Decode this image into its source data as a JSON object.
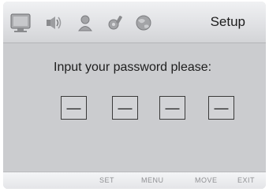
{
  "header": {
    "title": "Setup"
  },
  "icons": [
    "monitor-icon",
    "speaker-icon",
    "person-icon",
    "tools-icon",
    "globe-icon"
  ],
  "main": {
    "prompt": "Input your password please:",
    "password_slots": [
      "—",
      "—",
      "—",
      "—"
    ]
  },
  "footer": {
    "set_label": "SET",
    "menu_label": "MENU",
    "move_label": "MOVE",
    "exit_label": "EXIT"
  },
  "colors": {
    "background": "#cbcccf",
    "text": "#1e1e1e",
    "hint_text": "#8e8f92"
  }
}
